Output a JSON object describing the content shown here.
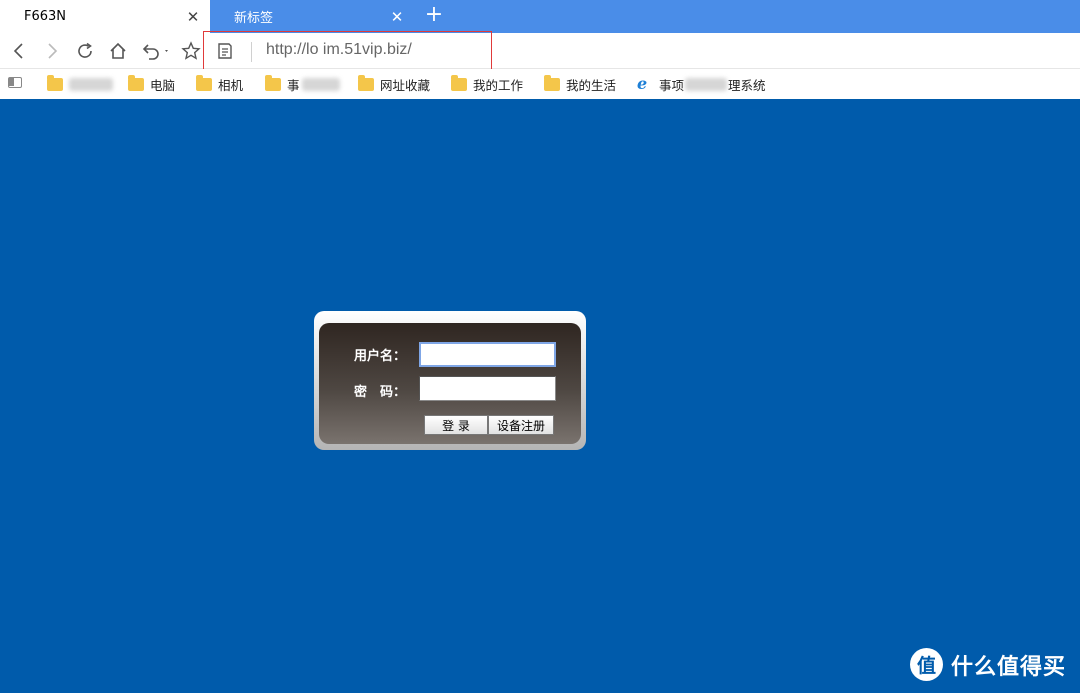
{
  "tabs": [
    {
      "title": "F663N",
      "active": true,
      "close": "✕"
    },
    {
      "title": "新标签",
      "active": false,
      "close": "✕"
    }
  ],
  "new_tab": "+",
  "toolbar": {
    "icons": [
      "back-icon",
      "forward-icon",
      "reload-icon",
      "home-icon",
      "undo-icon",
      "star-icon",
      "reader-icon"
    ],
    "address": "http://lo    im.51vip.biz/"
  },
  "bookmarks": [
    {
      "label": "电脑",
      "icon": "folder-icon"
    },
    {
      "label": "相机",
      "icon": "folder-icon"
    },
    {
      "label": "事",
      "icon": "folder-icon"
    },
    {
      "label": "网址收藏",
      "icon": "folder-icon"
    },
    {
      "label": "我的工作",
      "icon": "folder-icon"
    },
    {
      "label": "我的生活",
      "icon": "folder-icon"
    },
    {
      "label": "事项",
      "label_suffix": "理系统",
      "icon": "ie-icon"
    }
  ],
  "login": {
    "username_label": "用户名：",
    "password_label": "密　码：",
    "username_value": "",
    "password_value": "",
    "login_button": "登 录",
    "register_button": "设备注册"
  },
  "watermark": {
    "badge": "值",
    "text": "什么值得买"
  },
  "colors": {
    "page_background": "#005bab",
    "tab_bar": "#4a8de8",
    "highlight_box": "#e03a3a"
  }
}
